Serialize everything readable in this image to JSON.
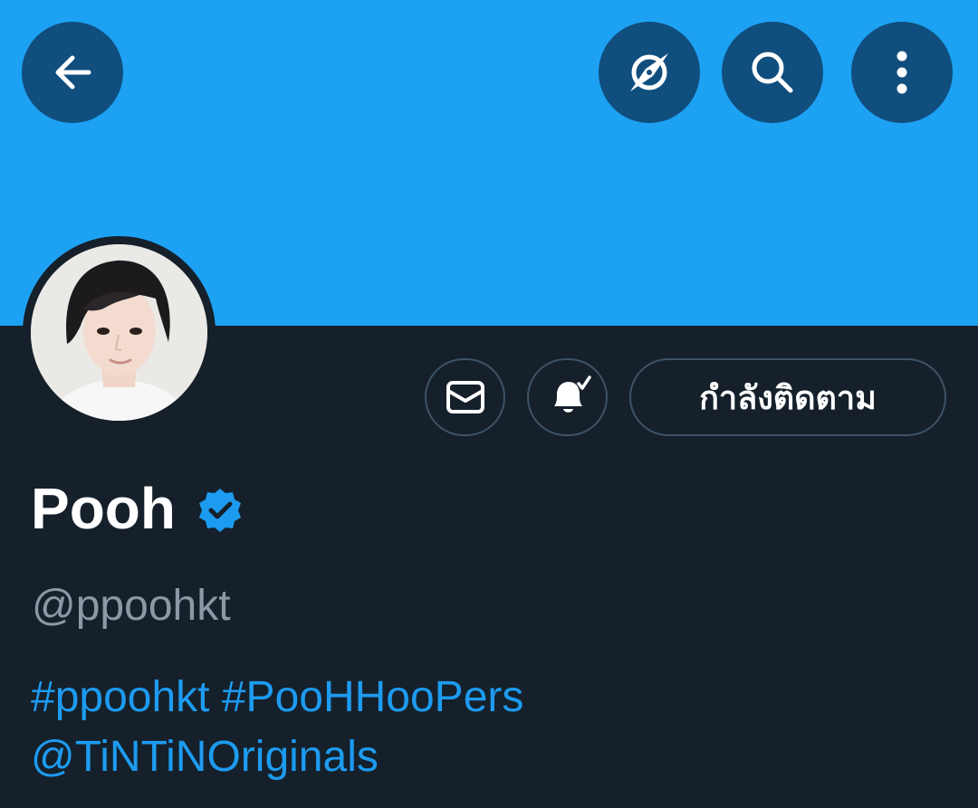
{
  "colors": {
    "banner": "#1da1f2",
    "background": "#15202b",
    "icon_button_bg": "#104e7e",
    "link": "#1d9bf0",
    "muted_text": "#8b98a5",
    "button_border": "#3e5366",
    "verified_badge": "#1d9bf0"
  },
  "topbar": {
    "back_icon": "arrow-left-icon",
    "explore_icon": "compass-icon",
    "search_icon": "search-icon",
    "more_icon": "more-vertical-icon"
  },
  "profile": {
    "avatar_icon": "avatar",
    "name": "Pooh",
    "verified_icon": "verified-badge-icon",
    "handle": "@ppoohkt",
    "bio": {
      "hashtag1": "#ppoohkt",
      "hashtag2": "#PooHHooPers",
      "mention": "@TiNTiNOriginals"
    }
  },
  "actions": {
    "message_icon": "mail-icon",
    "notifications_icon": "bell-check-icon",
    "follow_label": "กำลังติดตาม"
  }
}
